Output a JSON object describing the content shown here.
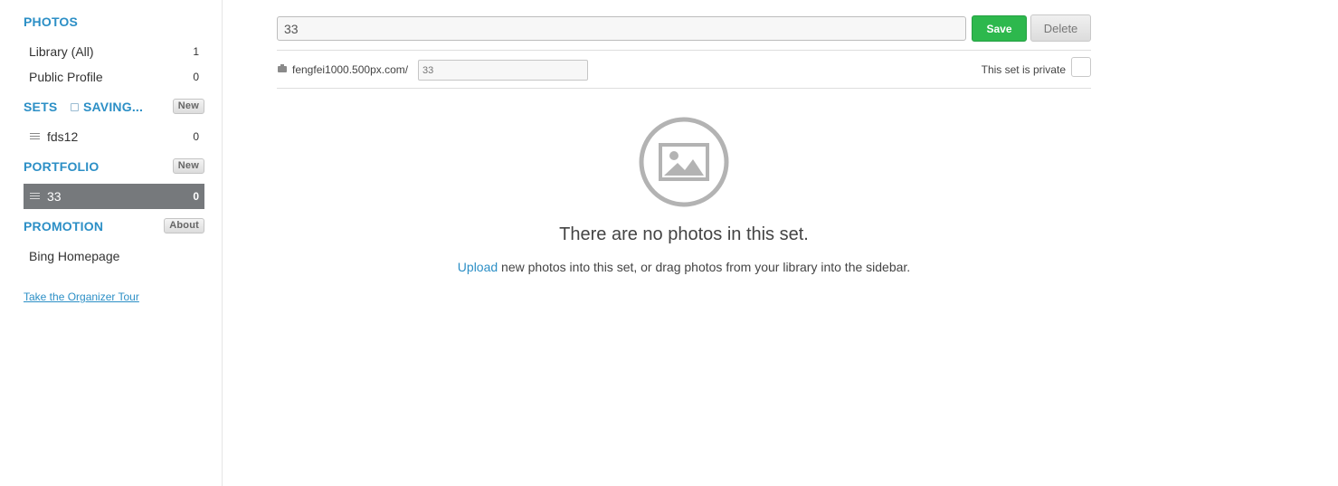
{
  "sidebar": {
    "photos": {
      "title": "PHOTOS",
      "items": [
        {
          "label": "Library (All)",
          "count": "1"
        },
        {
          "label": "Public Profile",
          "count": "0"
        }
      ]
    },
    "sets": {
      "title": "SETS",
      "status": "SAVING...",
      "button": "New",
      "items": [
        {
          "label": "fds12",
          "count": "0"
        }
      ]
    },
    "portfolio": {
      "title": "PORTFOLIO",
      "button": "New",
      "items": [
        {
          "label": "33",
          "count": "0"
        }
      ]
    },
    "promotion": {
      "title": "PROMOTION",
      "button": "About",
      "items": [
        {
          "label": "Bing Homepage"
        }
      ]
    },
    "tour_link": "Take the Organizer Tour"
  },
  "editor": {
    "set_title_value": "33",
    "save_label": "Save",
    "delete_label": "Delete",
    "url_prefix": "fengfei1000.500px.com/",
    "slug_placeholder": "33",
    "private_label": "This set is private"
  },
  "empty_state": {
    "title": "There are no photos in this set.",
    "upload_link": "Upload",
    "rest_text": " new photos into this set, or drag photos from your library into the sidebar."
  },
  "colors": {
    "accent": "#2c8fc6",
    "save": "#2db84d",
    "active_item": "#76797c"
  }
}
